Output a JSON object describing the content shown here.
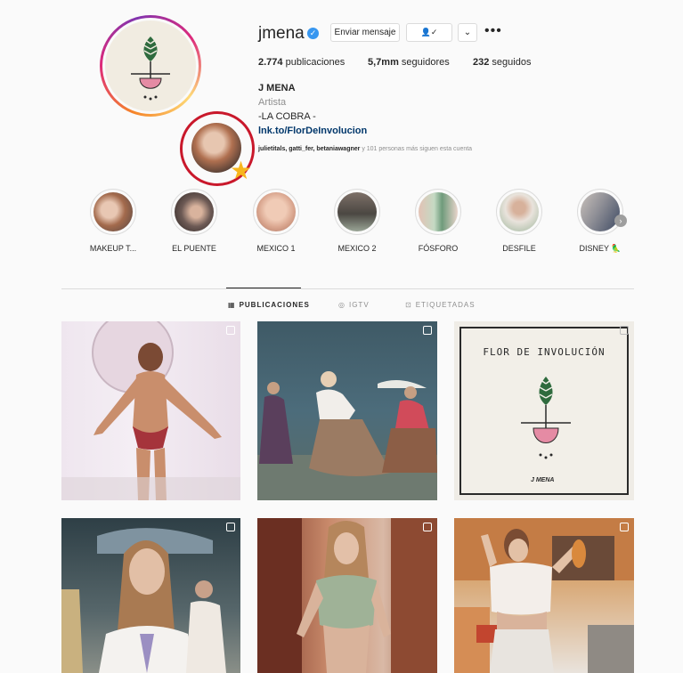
{
  "profile": {
    "username": "jmena",
    "verified_mark": "✓",
    "message_button": "Enviar mensaje",
    "follow_icon": "👤✓",
    "more_icon": "⌄",
    "options_icon": "•••",
    "posts_count": "2.774",
    "posts_label": "publicaciones",
    "followers_count": "5,7mm",
    "followers_label": "seguidores",
    "following_count": "232",
    "following_label": "seguidos",
    "name": "J MENA",
    "category": "Artista",
    "bio": "-LA COBRA -",
    "link": "lnk.to/FlorDeInvolucion",
    "followed_by_names": "julietitals, gatti_fer, betaniawagner",
    "followed_by_suffix": " y 101 personas más siguen esta cuenta"
  },
  "overlay": {
    "star_icon": "★",
    "highlight_color": "#c9182b"
  },
  "highlights": [
    {
      "label": "MAKEUP T..."
    },
    {
      "label": "EL PUENTE"
    },
    {
      "label": "MEXICO 1"
    },
    {
      "label": "MEXICO 2"
    },
    {
      "label": "FÓSFORO"
    },
    {
      "label": "DESFILE"
    },
    {
      "label": "DISNEY 🦜"
    }
  ],
  "highlights_next_icon": "›",
  "tabs": {
    "posts": {
      "icon": "▦",
      "label": "PUBLICACIONES"
    },
    "igtv": {
      "icon": "◎",
      "label": "IGTV"
    },
    "tagged": {
      "icon": "⊡",
      "label": "ETIQUETADAS"
    }
  },
  "grid": {
    "poster_title": "FLOR DE INVOLUCIÓN",
    "poster_brand": "J MENA"
  },
  "colors": {
    "accent_blue": "#3897f0",
    "link_blue": "#00376b",
    "star_yellow": "#f7b61d"
  }
}
